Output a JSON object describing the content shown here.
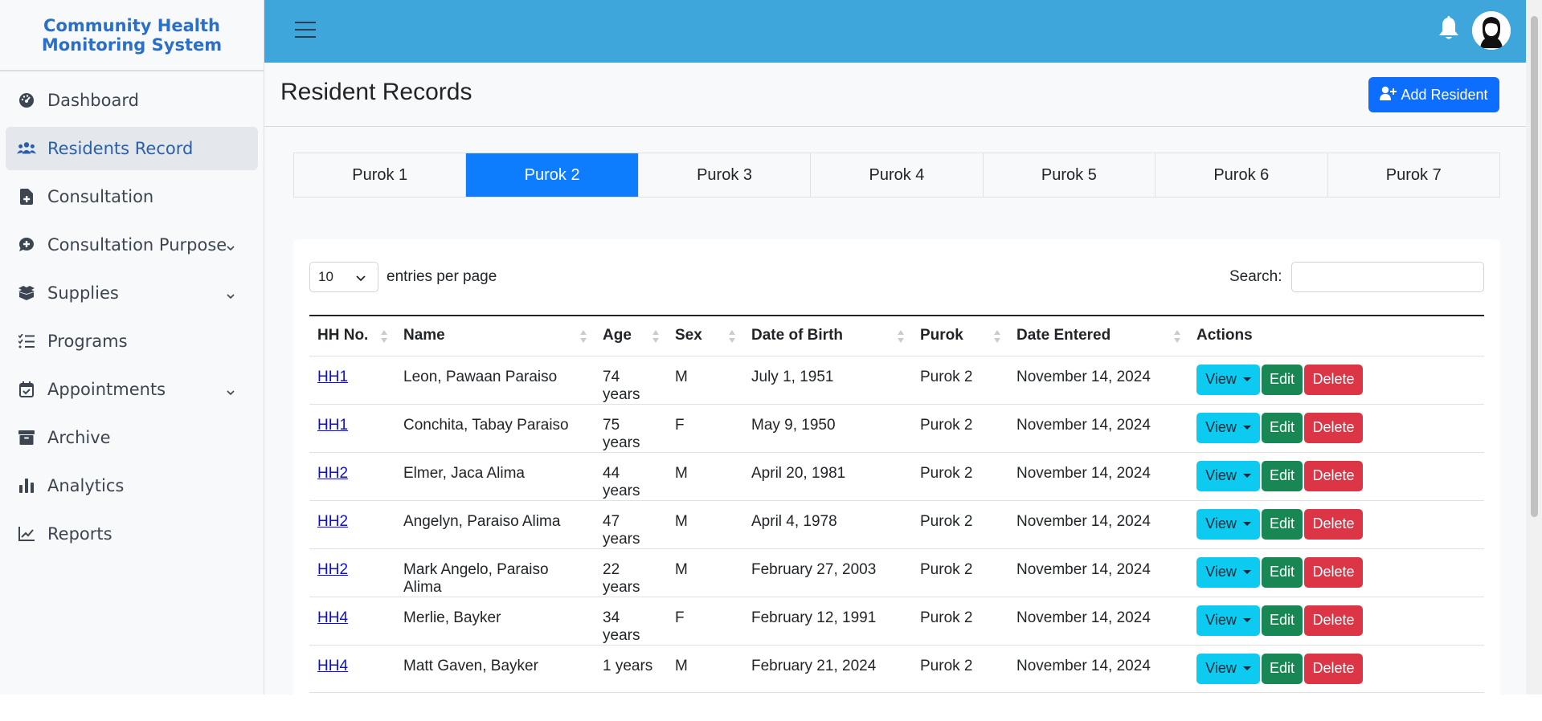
{
  "brand": {
    "line1": "Community Health",
    "line2": "Monitoring System"
  },
  "sidebar": {
    "items": [
      {
        "label": "Dashboard",
        "icon": "dashboard-gauge-icon",
        "active": false,
        "has_submenu": false
      },
      {
        "label": "Residents Record",
        "icon": "users-icon",
        "active": true,
        "has_submenu": false
      },
      {
        "label": "Consultation",
        "icon": "file-medical-icon",
        "active": false,
        "has_submenu": false
      },
      {
        "label": "Consultation Purpose",
        "icon": "comment-medical-icon",
        "active": false,
        "has_submenu": true
      },
      {
        "label": "Supplies",
        "icon": "boxes-icon",
        "active": false,
        "has_submenu": true
      },
      {
        "label": "Programs",
        "icon": "list-check-icon",
        "active": false,
        "has_submenu": false
      },
      {
        "label": "Appointments",
        "icon": "calendar-check-icon",
        "active": false,
        "has_submenu": true
      },
      {
        "label": "Archive",
        "icon": "archive-box-icon",
        "active": false,
        "has_submenu": false
      },
      {
        "label": "Analytics",
        "icon": "bar-chart-icon",
        "active": false,
        "has_submenu": false
      },
      {
        "label": "Reports",
        "icon": "line-chart-icon",
        "active": false,
        "has_submenu": false
      }
    ]
  },
  "header": {
    "title": "Resident Records",
    "add_button": "Add Resident"
  },
  "tabs": [
    {
      "label": "Purok 1",
      "active": false
    },
    {
      "label": "Purok 2",
      "active": true
    },
    {
      "label": "Purok 3",
      "active": false
    },
    {
      "label": "Purok 4",
      "active": false
    },
    {
      "label": "Purok 5",
      "active": false
    },
    {
      "label": "Purok 6",
      "active": false
    },
    {
      "label": "Purok 7",
      "active": false
    }
  ],
  "table_controls": {
    "entries_value": "10",
    "entries_label": "entries per page",
    "search_label": "Search:",
    "search_value": ""
  },
  "table": {
    "columns": [
      "HH No.",
      "Name",
      "Age",
      "Sex",
      "Date of Birth",
      "Purok",
      "Date Entered",
      "Actions"
    ],
    "rows": [
      {
        "hh": "HH1",
        "name": "Leon, Pawaan Paraiso",
        "age": "74 years",
        "sex": "M",
        "dob": "July 1, 1951",
        "purok": "Purok 2",
        "entered": "November 14, 2024"
      },
      {
        "hh": "HH1",
        "name": "Conchita, Tabay Paraiso",
        "age": "75 years",
        "sex": "F",
        "dob": "May 9, 1950",
        "purok": "Purok 2",
        "entered": "November 14, 2024"
      },
      {
        "hh": "HH2",
        "name": "Elmer, Jaca Alima",
        "age": "44 years",
        "sex": "M",
        "dob": "April 20, 1981",
        "purok": "Purok 2",
        "entered": "November 14, 2024"
      },
      {
        "hh": "HH2",
        "name": "Angelyn, Paraiso Alima",
        "age": "47 years",
        "sex": "M",
        "dob": "April 4, 1978",
        "purok": "Purok 2",
        "entered": "November 14, 2024"
      },
      {
        "hh": "HH2",
        "name": "Mark Angelo, Paraiso Alima",
        "age": "22 years",
        "sex": "M",
        "dob": "February 27, 2003",
        "purok": "Purok 2",
        "entered": "November 14, 2024"
      },
      {
        "hh": "HH4",
        "name": "Merlie, Bayker",
        "age": "34 years",
        "sex": "F",
        "dob": "February 12, 1991",
        "purok": "Purok 2",
        "entered": "November 14, 2024"
      },
      {
        "hh": "HH4",
        "name": "Matt Gaven, Bayker",
        "age": "1 years",
        "sex": "M",
        "dob": "February 21, 2024",
        "purok": "Purok 2",
        "entered": "November 14, 2024"
      }
    ],
    "actions": {
      "view": "View",
      "edit": "Edit",
      "delete": "Delete"
    }
  },
  "colors": {
    "topbar": "#3fa6dc",
    "primary": "#0d6efd",
    "brand_text": "#2a6fc9",
    "view": "#0dcaf0",
    "edit": "#198754",
    "delete": "#dc3545"
  }
}
